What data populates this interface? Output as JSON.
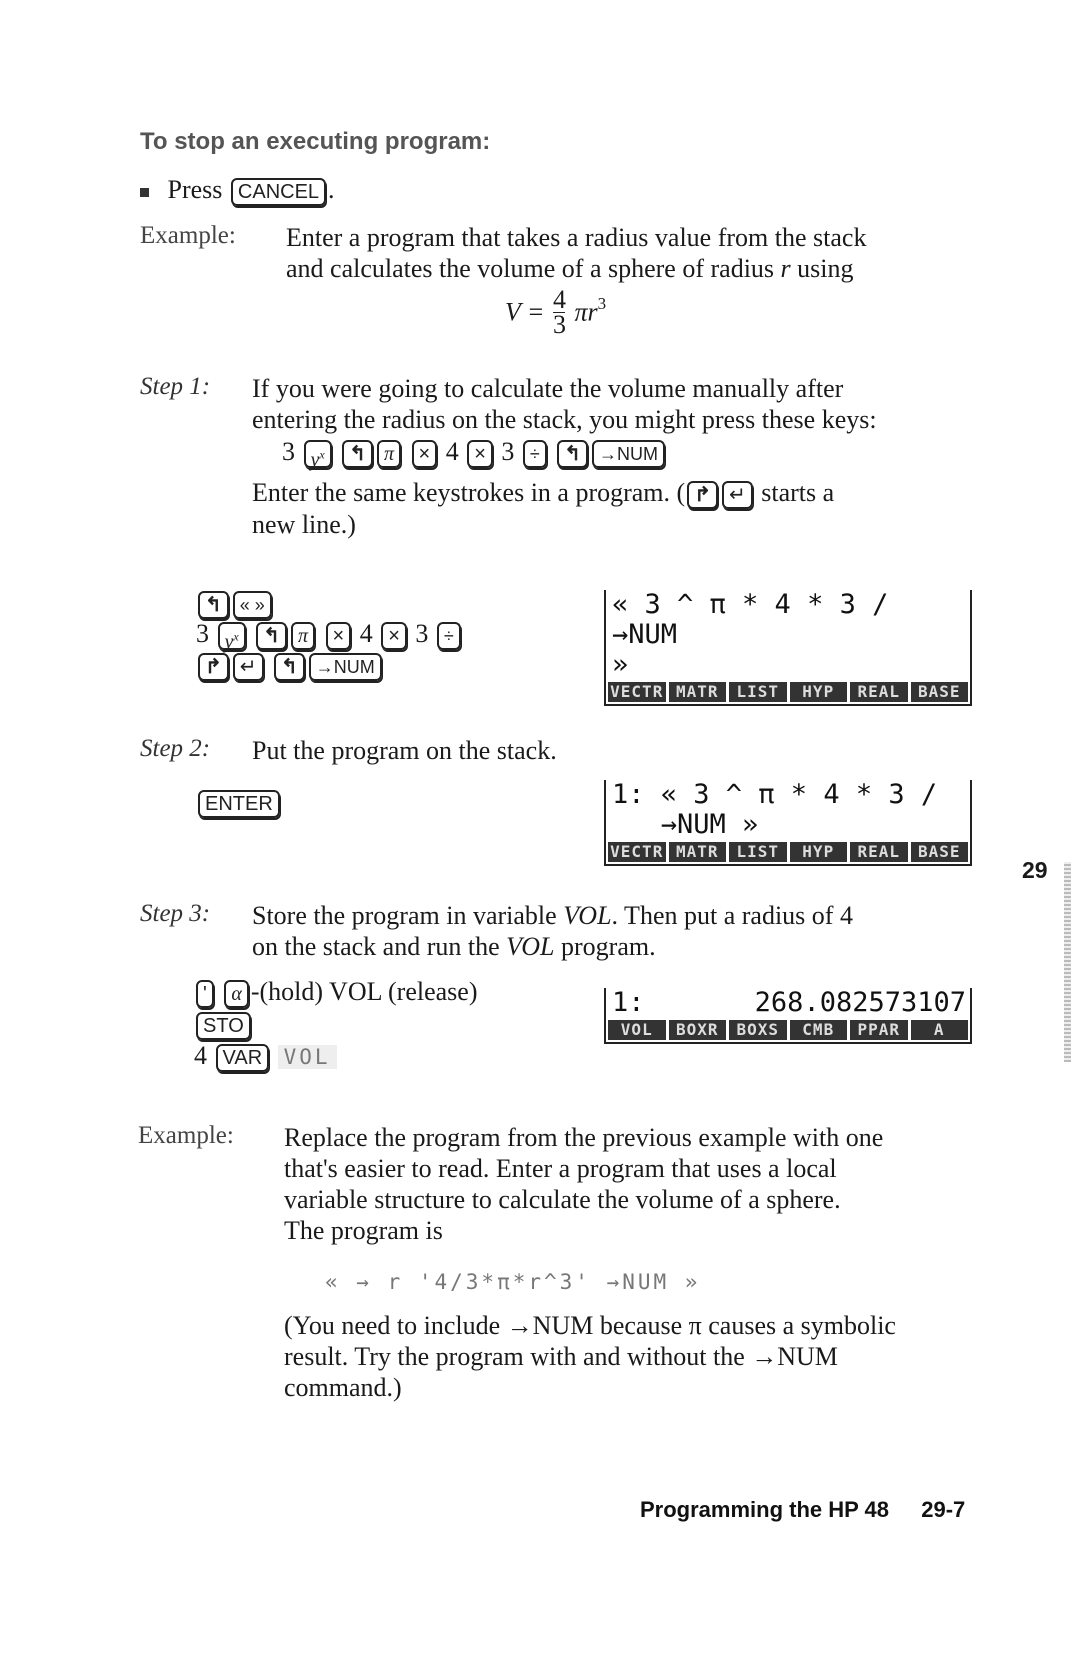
{
  "section": {
    "heading": "To stop an executing program:",
    "bullet": {
      "prefix": "Press",
      "key": "CANCEL",
      "suffix": "."
    }
  },
  "example1": {
    "label": "Example:",
    "text_line1": "Enter a program that takes a radius value from the stack",
    "text_line2_a": "and calculates the volume of a sphere of radius ",
    "text_line2_var": "r",
    "text_line2_b": " using",
    "formula": {
      "lhs": "V =",
      "numerator": "4",
      "denominator": "3",
      "rest": "πr",
      "exponent": "3"
    }
  },
  "step1": {
    "label": "Step 1:",
    "line1": "If you were going to calculate the volume manually after",
    "line2": "entering the radius on the stack, you might press these keys:",
    "keys": [
      "3",
      "yˣ",
      "◀shift",
      "π",
      "×",
      "4",
      "×",
      "3",
      "÷",
      "◀shift",
      "→NUM"
    ],
    "line3_a": "Enter the same keystrokes in a program. (",
    "line3_b": " starts a",
    "line4": "new line.)",
    "keystroke_rows": [
      [
        "◀shift",
        "« »"
      ],
      [
        "3",
        "yˣ",
        "◀shift",
        "π",
        "×",
        "4",
        "×",
        "3",
        "÷"
      ],
      [
        "▶shift",
        "↵",
        "◀shift",
        "→NUM"
      ]
    ],
    "lcd": {
      "lines": [
        "« 3 ^ π * 4 * 3 /",
        "→NUM",
        "»"
      ],
      "menu": [
        "VECTR",
        "MATR",
        "LIST",
        "HYP",
        "REAL",
        "BASE"
      ]
    }
  },
  "step2": {
    "label": "Step 2:",
    "text": "Put the program on the stack.",
    "key": "ENTER",
    "lcd": {
      "lines": [
        "1: « 3 ^ π * 4 * 3 /",
        "   →NUM »"
      ],
      "menu": [
        "VECTR",
        "MATR",
        "LIST",
        "HYP",
        "REAL",
        "BASE"
      ]
    }
  },
  "tab": {
    "chapter": "29"
  },
  "step3": {
    "label": "Step 3:",
    "line1_a": "Store the program in variable ",
    "line1_var": "VOL",
    "line1_b": ". Then put a radius of 4",
    "line2_a": "on the stack and run the ",
    "line2_var": "VOL",
    "line2_b": " program.",
    "keys_row1": {
      "key1": "'",
      "key2": "α",
      "text": "-(hold) VOL (release)"
    },
    "keys_row2": {
      "key": "STO"
    },
    "keys_row3": {
      "prefix": "4",
      "key": "VAR",
      "softkey": "VOL"
    },
    "lcd": {
      "stack_label": "1:",
      "value": "268.082573107",
      "menu": [
        "VOL",
        "BOXR",
        "BOXS",
        "CMB",
        "PPAR",
        "A"
      ]
    }
  },
  "example2": {
    "label": "Example:",
    "lines": [
      "Replace the program from the previous example with one",
      "that's easier to read. Enter a program that uses a local",
      "variable structure to calculate the volume of a sphere.",
      "The program is"
    ],
    "program": "« → r '4/3*π*r^3' →NUM »",
    "note": [
      "(You need to include →NUM because π causes a symbolic",
      "result. Try the program with and without the →NUM",
      "command.)"
    ]
  },
  "footer": {
    "title": "Programming the HP 48",
    "page": "29-7"
  }
}
